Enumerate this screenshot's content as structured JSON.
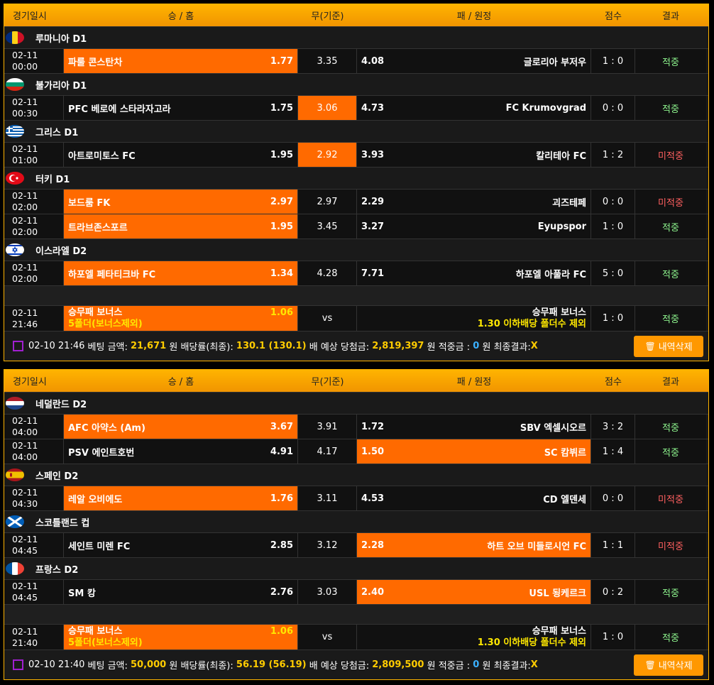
{
  "columns": {
    "date": "경기일시",
    "home": "승 / 홈",
    "draw": "무(기준)",
    "away": "패 / 원정",
    "score": "점수",
    "result": "결과"
  },
  "panels": [
    {
      "leagues": [
        {
          "name": "루마니아 D1",
          "flag": "romania",
          "games": [
            {
              "d1": "02-11",
              "d2": "00:00",
              "home": "파룰 콘스탄차",
              "hodd": "1.77",
              "draw": "3.35",
              "away": "글로리아 부저우",
              "aodd": "4.08",
              "score": "1 : 0",
              "result": "적중",
              "pick": "home",
              "status": "hit"
            }
          ]
        },
        {
          "name": "불가리아 D1",
          "flag": "bulgaria",
          "games": [
            {
              "d1": "02-11",
              "d2": "00:30",
              "home": "PFC 베로에 스타라자고라",
              "hodd": "1.75",
              "draw": "3.06",
              "away": "FC Krumovgrad",
              "aodd": "4.73",
              "score": "0 : 0",
              "result": "적중",
              "pick": "draw",
              "status": "hit"
            }
          ]
        },
        {
          "name": "그리스 D1",
          "flag": "greece",
          "games": [
            {
              "d1": "02-11",
              "d2": "01:00",
              "home": "아트로미토스 FC",
              "hodd": "1.95",
              "draw": "2.92",
              "away": "칼리테아 FC",
              "aodd": "3.93",
              "score": "1 : 2",
              "result": "미적중",
              "pick": "draw",
              "status": "miss"
            }
          ]
        },
        {
          "name": "터키 D1",
          "flag": "turkey",
          "games": [
            {
              "d1": "02-11",
              "d2": "02:00",
              "home": "보드룸 FK",
              "hodd": "2.97",
              "draw": "2.97",
              "away": "괴즈테페",
              "aodd": "2.29",
              "score": "0 : 0",
              "result": "미적중",
              "pick": "home",
              "status": "miss"
            },
            {
              "d1": "02-11",
              "d2": "02:00",
              "home": "트라브존스포르",
              "hodd": "1.95",
              "draw": "3.45",
              "away": "Eyupspor",
              "aodd": "3.27",
              "score": "1 : 0",
              "result": "적중",
              "pick": "home",
              "status": "hit"
            }
          ]
        },
        {
          "name": "이스라엘 D2",
          "flag": "israel",
          "games": [
            {
              "d1": "02-11",
              "d2": "02:00",
              "home": "하포엘 페타티크바 FC",
              "hodd": "1.34",
              "draw": "4.28",
              "away": "하포엘 아풀라 FC",
              "aodd": "7.71",
              "score": "5 : 0",
              "result": "적중",
              "pick": "home",
              "status": "hit"
            }
          ]
        }
      ],
      "bonus": {
        "d1": "02-11",
        "d2": "21:46",
        "home1": "승무패 보너스",
        "hodd": "1.06",
        "home2": "5폴더(보너스제외)",
        "vs": "vs",
        "away1": "승무패 보너스",
        "away2": "1.30 이하배당 폴더수 제외",
        "score": "1 : 0",
        "result": "적중"
      },
      "footer": {
        "date": "02-10 21:46",
        "bet_label": "베팅 금액:",
        "bet": "21,671",
        "won1": "원",
        "rate_label": "배당률(최종):",
        "rate": "130.1 (130.1)",
        "bae": "배",
        "exp_label": "예상 당첨금:",
        "exp": "2,819,397",
        "won2": "원",
        "hit_label": "적중금 :",
        "hit": "0",
        "won3": "원",
        "final_label": "최종결과:",
        "final": "X",
        "delete": "내역삭제"
      }
    },
    {
      "leagues": [
        {
          "name": "네덜란드 D2",
          "flag": "netherlands",
          "games": [
            {
              "d1": "02-11",
              "d2": "04:00",
              "home": "AFC 아약스 (Am)",
              "hodd": "3.67",
              "draw": "3.91",
              "away": "SBV 엑셀시오르",
              "aodd": "1.72",
              "score": "3 : 2",
              "result": "적중",
              "pick": "home",
              "status": "hit"
            },
            {
              "d1": "02-11",
              "d2": "04:00",
              "home": "PSV 에인트호번",
              "hodd": "4.91",
              "draw": "4.17",
              "away": "SC 캄뷔르",
              "aodd": "1.50",
              "score": "1 : 4",
              "result": "적중",
              "pick": "away",
              "status": "hit"
            }
          ]
        },
        {
          "name": "스페인 D2",
          "flag": "spain",
          "games": [
            {
              "d1": "02-11",
              "d2": "04:30",
              "home": "레알 오비에도",
              "hodd": "1.76",
              "draw": "3.11",
              "away": "CD 엘덴세",
              "aodd": "4.53",
              "score": "0 : 0",
              "result": "미적중",
              "pick": "home",
              "status": "miss"
            }
          ]
        },
        {
          "name": "스코틀랜드 컵",
          "flag": "scotland",
          "games": [
            {
              "d1": "02-11",
              "d2": "04:45",
              "home": "세인트 미렌 FC",
              "hodd": "2.85",
              "draw": "3.12",
              "away": "하트 오브 미들로시언 FC",
              "aodd": "2.28",
              "score": "1 : 1",
              "result": "미적중",
              "pick": "away",
              "status": "miss"
            }
          ]
        },
        {
          "name": "프랑스 D2",
          "flag": "france",
          "games": [
            {
              "d1": "02-11",
              "d2": "04:45",
              "home": "SM 캉",
              "hodd": "2.76",
              "draw": "3.03",
              "away": "USL 됭케르크",
              "aodd": "2.40",
              "score": "0 : 2",
              "result": "적중",
              "pick": "away",
              "status": "hit"
            }
          ]
        }
      ],
      "bonus": {
        "d1": "02-11",
        "d2": "21:40",
        "home1": "승무패 보너스",
        "hodd": "1.06",
        "home2": "5폴더(보너스제외)",
        "vs": "vs",
        "away1": "승무패 보너스",
        "away2": "1.30 이하배당 폴더수 제외",
        "score": "1 : 0",
        "result": "적중"
      },
      "footer": {
        "date": "02-10 21:40",
        "bet_label": "베팅 금액:",
        "bet": "50,000",
        "won1": "원",
        "rate_label": "배당률(최종):",
        "rate": "56.19 (56.19)",
        "bae": "배",
        "exp_label": "예상 당첨금:",
        "exp": "2,809,500",
        "won2": "원",
        "hit_label": "적중금 :",
        "hit": "0",
        "won3": "원",
        "final_label": "최종결과:",
        "final": "X",
        "delete": "내역삭제"
      }
    }
  ]
}
